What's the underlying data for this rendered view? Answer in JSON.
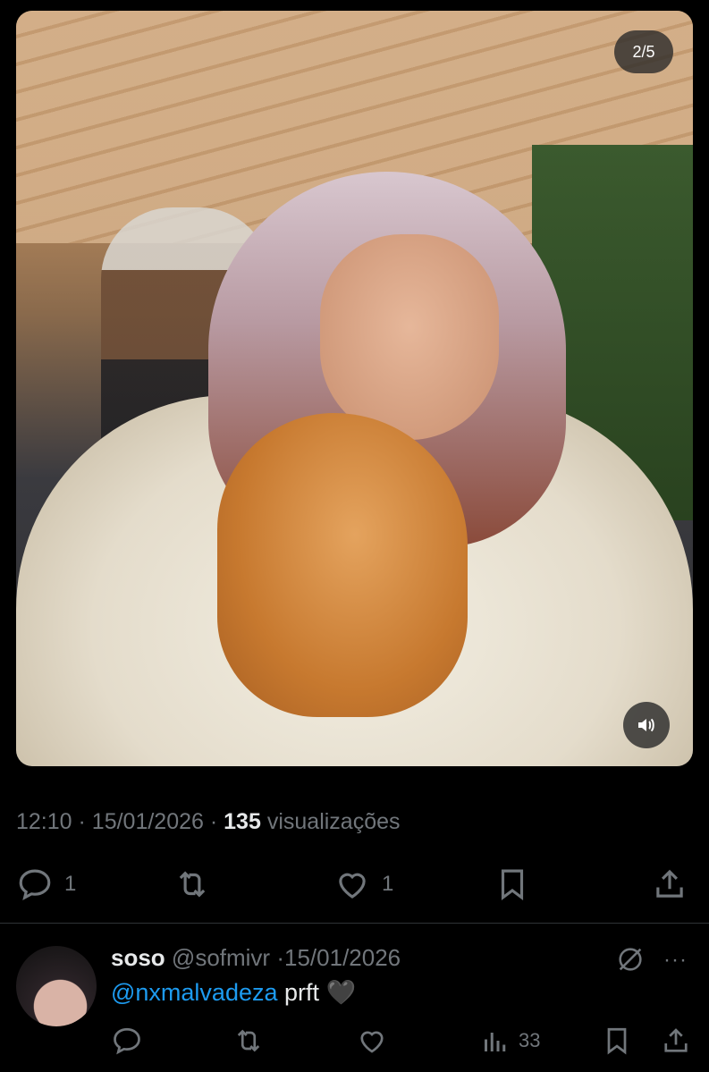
{
  "media": {
    "counter": "2/5",
    "icons": {
      "volume": "volume-icon"
    }
  },
  "post": {
    "time": "12:10",
    "date": "15/01/2026",
    "views_count": "135",
    "views_label": "visualizações",
    "replies": "1",
    "likes": "1"
  },
  "reply": {
    "name": "soso",
    "handle": "@sofmivr",
    "date": "15/01/2026",
    "mention": "@nxmalvadeza",
    "text": "prft 🖤",
    "views": "33"
  },
  "colors": {
    "accent": "#1d9bf0",
    "muted": "#71767b",
    "text": "#e7e9ea",
    "bg": "#000000"
  }
}
